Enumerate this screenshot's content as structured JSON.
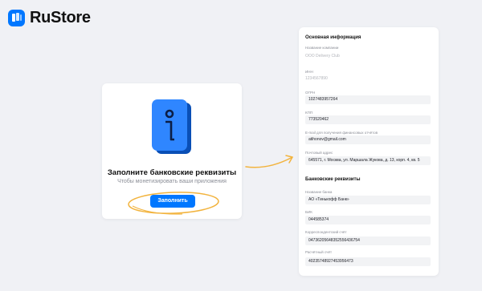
{
  "brand": {
    "name": "RuStore",
    "color": "#0077ff"
  },
  "card": {
    "icon": "info-icon",
    "title": "Заполните банковские реквизиты",
    "subtitle": "Чтобы монетизировать ваши приложения",
    "button_label": "Заполнить"
  },
  "form": {
    "basic_title": "Основная информация",
    "basic_fields": [
      {
        "label": "Название компании",
        "value": "ООО Delivery Club",
        "disabled": true
      },
      {
        "label": "ИНН",
        "value": "1234567890",
        "disabled": true
      },
      {
        "label": "ОГРН",
        "value": "1027483957264",
        "disabled": false
      },
      {
        "label": "КПП",
        "value": "773520462",
        "disabled": false
      },
      {
        "label": "E-mail для получения финансовых отчётов",
        "value": "atihonov@gmail.com",
        "disabled": false
      },
      {
        "label": "Почтовый адрес",
        "value": "645571, г. Москва, ул. Маршала Жукова, д. 13, корп. 4, кв. 5",
        "disabled": false
      }
    ],
    "bank_title": "Банковские реквизиты",
    "bank_fields": [
      {
        "label": "Название банка",
        "value": "АО «Тинькофф Банк»"
      },
      {
        "label": "БИК",
        "value": "044585374"
      },
      {
        "label": "Корреспондентский счёт",
        "value": "04736205648352556436754"
      },
      {
        "label": "Расчётный счёт",
        "value": "40235748927453956473"
      }
    ]
  },
  "colors": {
    "accent": "#0077ff",
    "annotation": "#f2b33d",
    "background": "#f0f1f5"
  }
}
